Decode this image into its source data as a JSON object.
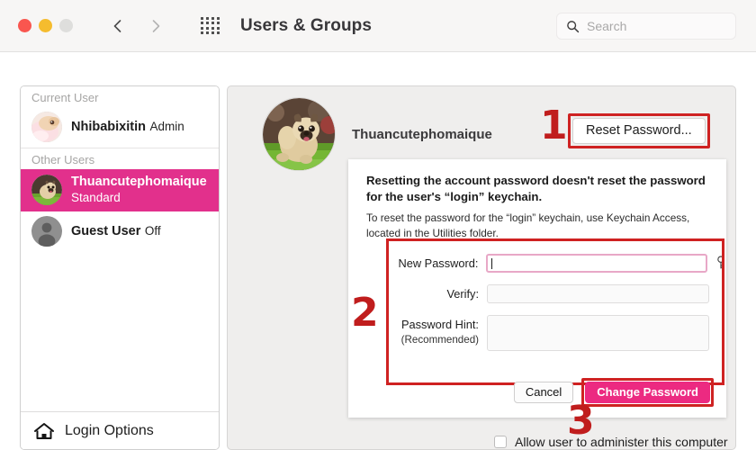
{
  "window": {
    "title": "Users & Groups",
    "traffic_lights": [
      "close",
      "minimize",
      "zoom"
    ],
    "back_icon": "chevron-left-icon",
    "forward_icon": "chevron-right-icon",
    "grid_icon": "show-all-preferences-icon",
    "colors": {
      "selection_pink": "#e2308c",
      "primary_button_pink": "#ec2a81",
      "annotation_red": "#cf2222"
    }
  },
  "search": {
    "placeholder": "Search",
    "icon": "search-icon"
  },
  "sidebar": {
    "groups": [
      {
        "header": "Current User",
        "users": [
          {
            "name": "Nhibabixitin",
            "role": "Admin",
            "selected": false,
            "avatar": "bird-photo-avatar"
          }
        ]
      },
      {
        "header": "Other Users",
        "users": [
          {
            "name": "Thuancutephomaique",
            "role": "Standard",
            "selected": true,
            "avatar": "pug-photo-avatar"
          },
          {
            "name": "Guest User",
            "role": "Off",
            "selected": false,
            "avatar": "generic-person-avatar"
          }
        ]
      }
    ],
    "footer": {
      "label": "Login Options",
      "icon": "home-icon"
    }
  },
  "content": {
    "account": {
      "name": "Thuancutephomaique",
      "avatar": "pug-photo-avatar"
    },
    "reset_password_button": "Reset Password...",
    "admin_checkbox_label": "Allow user to administer this computer"
  },
  "sheet": {
    "title": "Resetting the account password doesn't reset the password for the user's “login” keychain.",
    "subtitle": "To reset the password for the “login” keychain, use Keychain Access, located in the Utilities folder.",
    "fields": [
      {
        "label": "New Password:",
        "sublabel": "",
        "value": "",
        "focused": true,
        "has_key_icon": true
      },
      {
        "label": "Verify:",
        "sublabel": "",
        "value": "",
        "focused": false,
        "has_key_icon": false
      },
      {
        "label": "Password Hint:",
        "sublabel": "(Recommended)",
        "value": "",
        "focused": false,
        "has_key_icon": false
      }
    ],
    "cancel_button": "Cancel",
    "change_button": "Change Password"
  },
  "annotations": {
    "step1": "1",
    "step2": "2",
    "step3": "3"
  }
}
